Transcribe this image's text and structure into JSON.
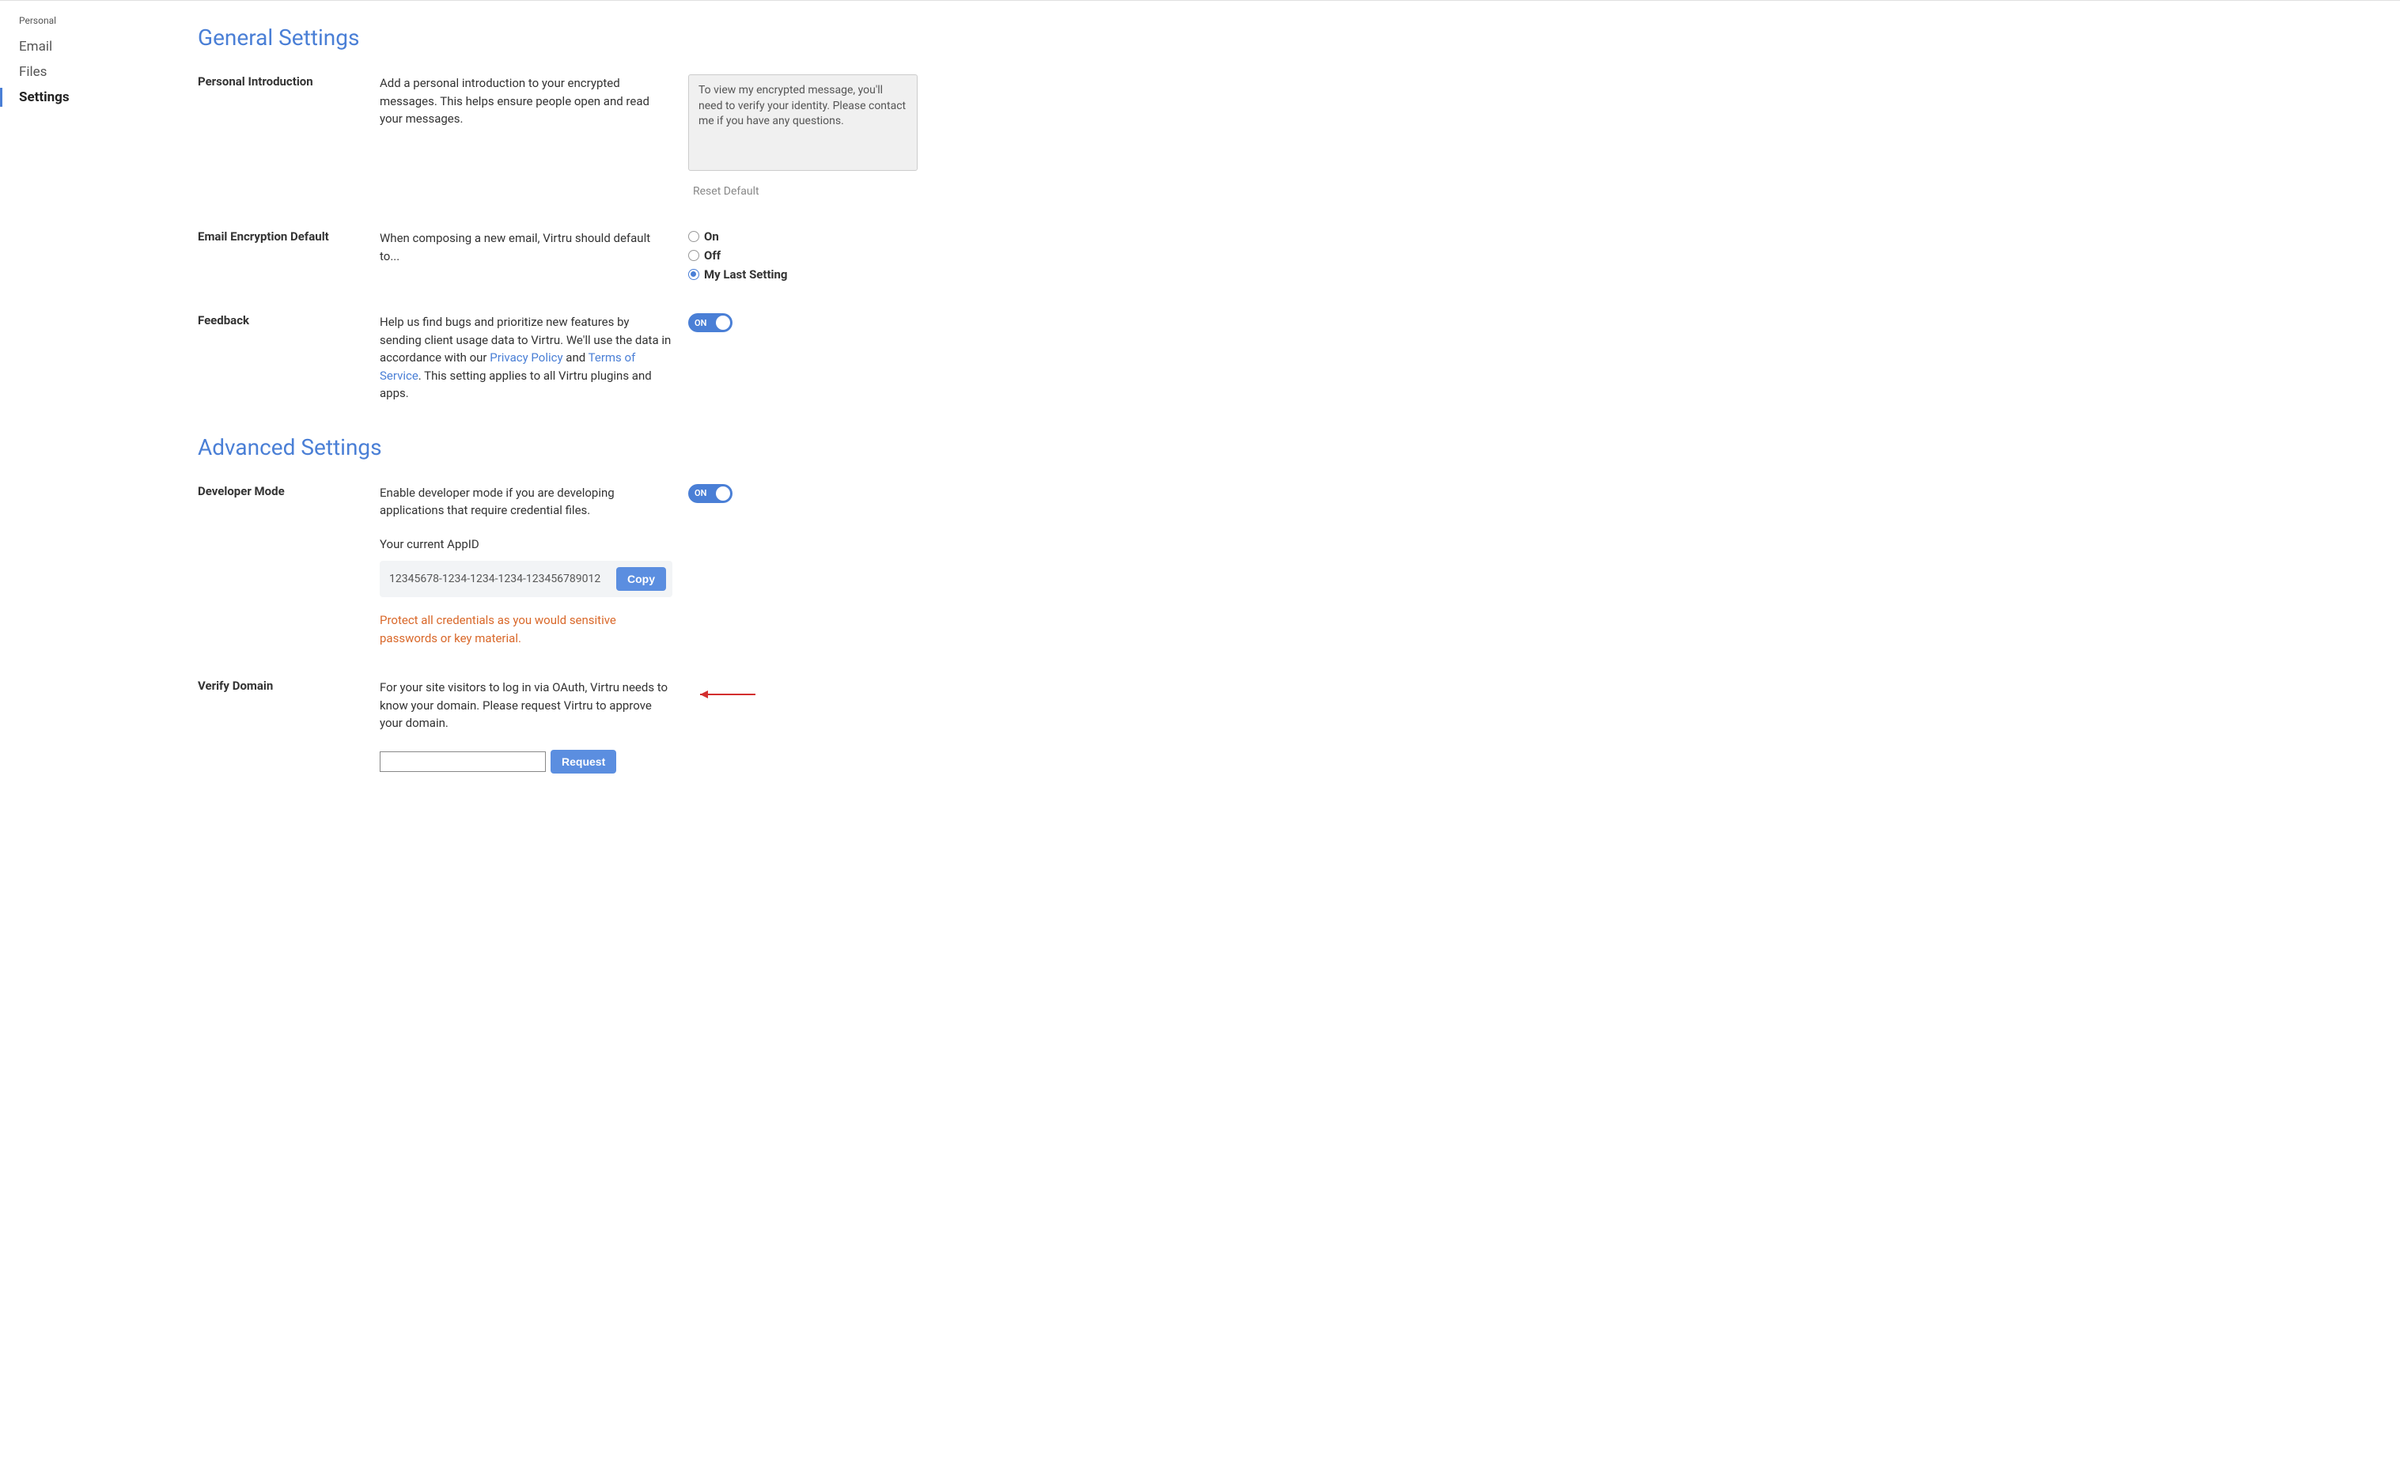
{
  "sidebar": {
    "category": "Personal",
    "items": [
      {
        "label": "Email",
        "active": false
      },
      {
        "label": "Files",
        "active": false
      },
      {
        "label": "Settings",
        "active": true
      }
    ]
  },
  "sections": {
    "general": {
      "title": "General Settings",
      "personal_intro": {
        "label": "Personal Introduction",
        "description": "Add a personal introduction to your encrypted messages. This helps ensure people open and read your messages.",
        "value": "To view my encrypted message, you'll need to verify your identity. Please contact me if you have any questions.",
        "reset_label": "Reset Default"
      },
      "email_encryption": {
        "label": "Email Encryption Default",
        "description": "When composing a new email, Virtru should default to...",
        "options": {
          "on": "On",
          "off": "Off",
          "last": "My Last Setting"
        },
        "selected": "last"
      },
      "feedback": {
        "label": "Feedback",
        "desc_part1": "Help us find bugs and prioritize new features by sending client usage data to Virtru. We'll use the data in accordance with our ",
        "privacy_link": "Privacy Policy",
        "desc_and": " and ",
        "tos_link": "Terms of Service",
        "desc_part2": ". This setting applies to all Virtru plugins and apps.",
        "toggle_label": "ON"
      }
    },
    "advanced": {
      "title": "Advanced Settings",
      "developer_mode": {
        "label": "Developer Mode",
        "description": "Enable developer mode if you are developing applications that require credential files.",
        "appid_label": "Your current AppID",
        "appid_value": "12345678-1234-1234-1234-123456789012",
        "copy_label": "Copy",
        "warning": "Protect all credentials as you would sensitive passwords or key material.",
        "toggle_label": "ON"
      },
      "verify_domain": {
        "label": "Verify Domain",
        "description": "For your site visitors to log in via OAuth, Virtru needs to know your domain. Please request Virtru to approve your domain.",
        "request_label": "Request",
        "input_value": ""
      }
    }
  }
}
